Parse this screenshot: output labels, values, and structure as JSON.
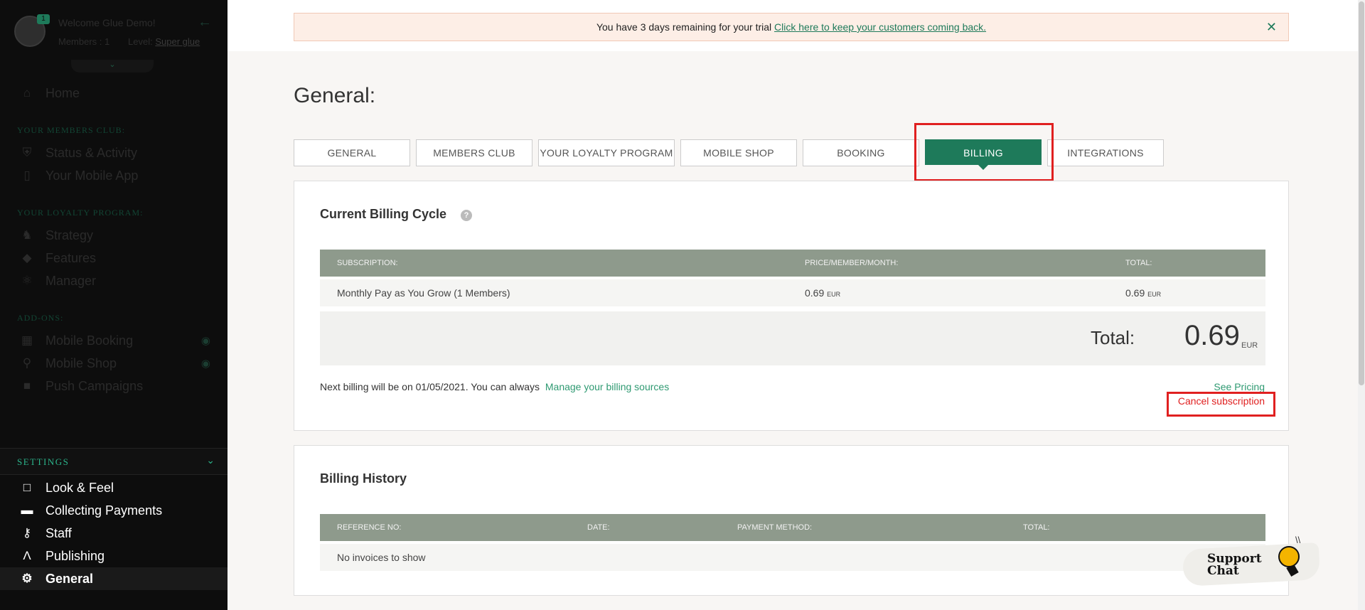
{
  "sidebar": {
    "welcome": "Welcome Glue Demo!",
    "members_label": "Members :",
    "members_count": "1",
    "level_label": "Level:",
    "level_value": "Super glue",
    "badge": "1",
    "nav": [
      {
        "label": "Home",
        "icon": "home-icon"
      }
    ],
    "section_members_club": "YOUR MEMBERS CLUB:",
    "members_club_items": [
      {
        "label": "Status & Activity",
        "icon": "shield-icon"
      },
      {
        "label": "Your Mobile App",
        "icon": "mobile-icon"
      }
    ],
    "section_loyalty": "YOUR LOYALTY PROGRAM:",
    "loyalty_items": [
      {
        "label": "Strategy",
        "icon": "chess-icon"
      },
      {
        "label": "Features",
        "icon": "tag-icon"
      },
      {
        "label": "Manager",
        "icon": "atom-icon"
      }
    ],
    "section_addons": "ADD-ONS:",
    "addon_items": [
      {
        "label": "Mobile Booking",
        "icon": "calendar-icon"
      },
      {
        "label": "Mobile Shop",
        "icon": "cart-icon"
      },
      {
        "label": "Push Campaigns",
        "icon": "chat-icon"
      }
    ],
    "settings_label": "SETTINGS",
    "settings_items": [
      {
        "label": "Look & Feel",
        "icon": "paint-roller-icon"
      },
      {
        "label": "Collecting Payments",
        "icon": "credit-card-icon"
      },
      {
        "label": "Staff",
        "icon": "key-icon"
      },
      {
        "label": "Publishing",
        "icon": "publish-icon"
      },
      {
        "label": "General",
        "icon": "gears-icon"
      }
    ]
  },
  "trial": {
    "text": "You have 3 days remaining for your trial",
    "link": "Click here to keep your customers coming back."
  },
  "page_title": "General:",
  "tabs": [
    "GENERAL",
    "MEMBERS CLUB",
    "YOUR LOYALTY PROGRAM",
    "MOBILE SHOP",
    "BOOKING",
    "BILLING",
    "INTEGRATIONS"
  ],
  "active_tab": "BILLING",
  "billing_cycle": {
    "title": "Current Billing Cycle",
    "headers": [
      "SUBSCRIPTION:",
      "PRICE/MEMBER/MONTH:",
      "TOTAL:"
    ],
    "row": {
      "subscription": "Monthly Pay as You Grow (1 Members)",
      "price": "0.69",
      "price_currency": "EUR",
      "total": "0.69",
      "total_currency": "EUR"
    },
    "total_label": "Total:",
    "total_value": "0.69",
    "total_currency": "EUR",
    "next_billing": "Next billing will be on 01/05/2021. You can always",
    "manage_link": "Manage your billing sources",
    "see_pricing": "See Pricing",
    "cancel_subscription": "Cancel subscription"
  },
  "billing_history": {
    "title": "Billing History",
    "headers": [
      "REFERENCE NO:",
      "DATE:",
      "PAYMENT METHOD:",
      "TOTAL:"
    ],
    "empty": "No invoices to show"
  },
  "support_chat": {
    "line1": "Support",
    "line2": "Chat"
  },
  "colors": {
    "accent": "#1e7a5a",
    "highlight": "#e02020",
    "sidebar_bg": "#0d0d0d"
  }
}
